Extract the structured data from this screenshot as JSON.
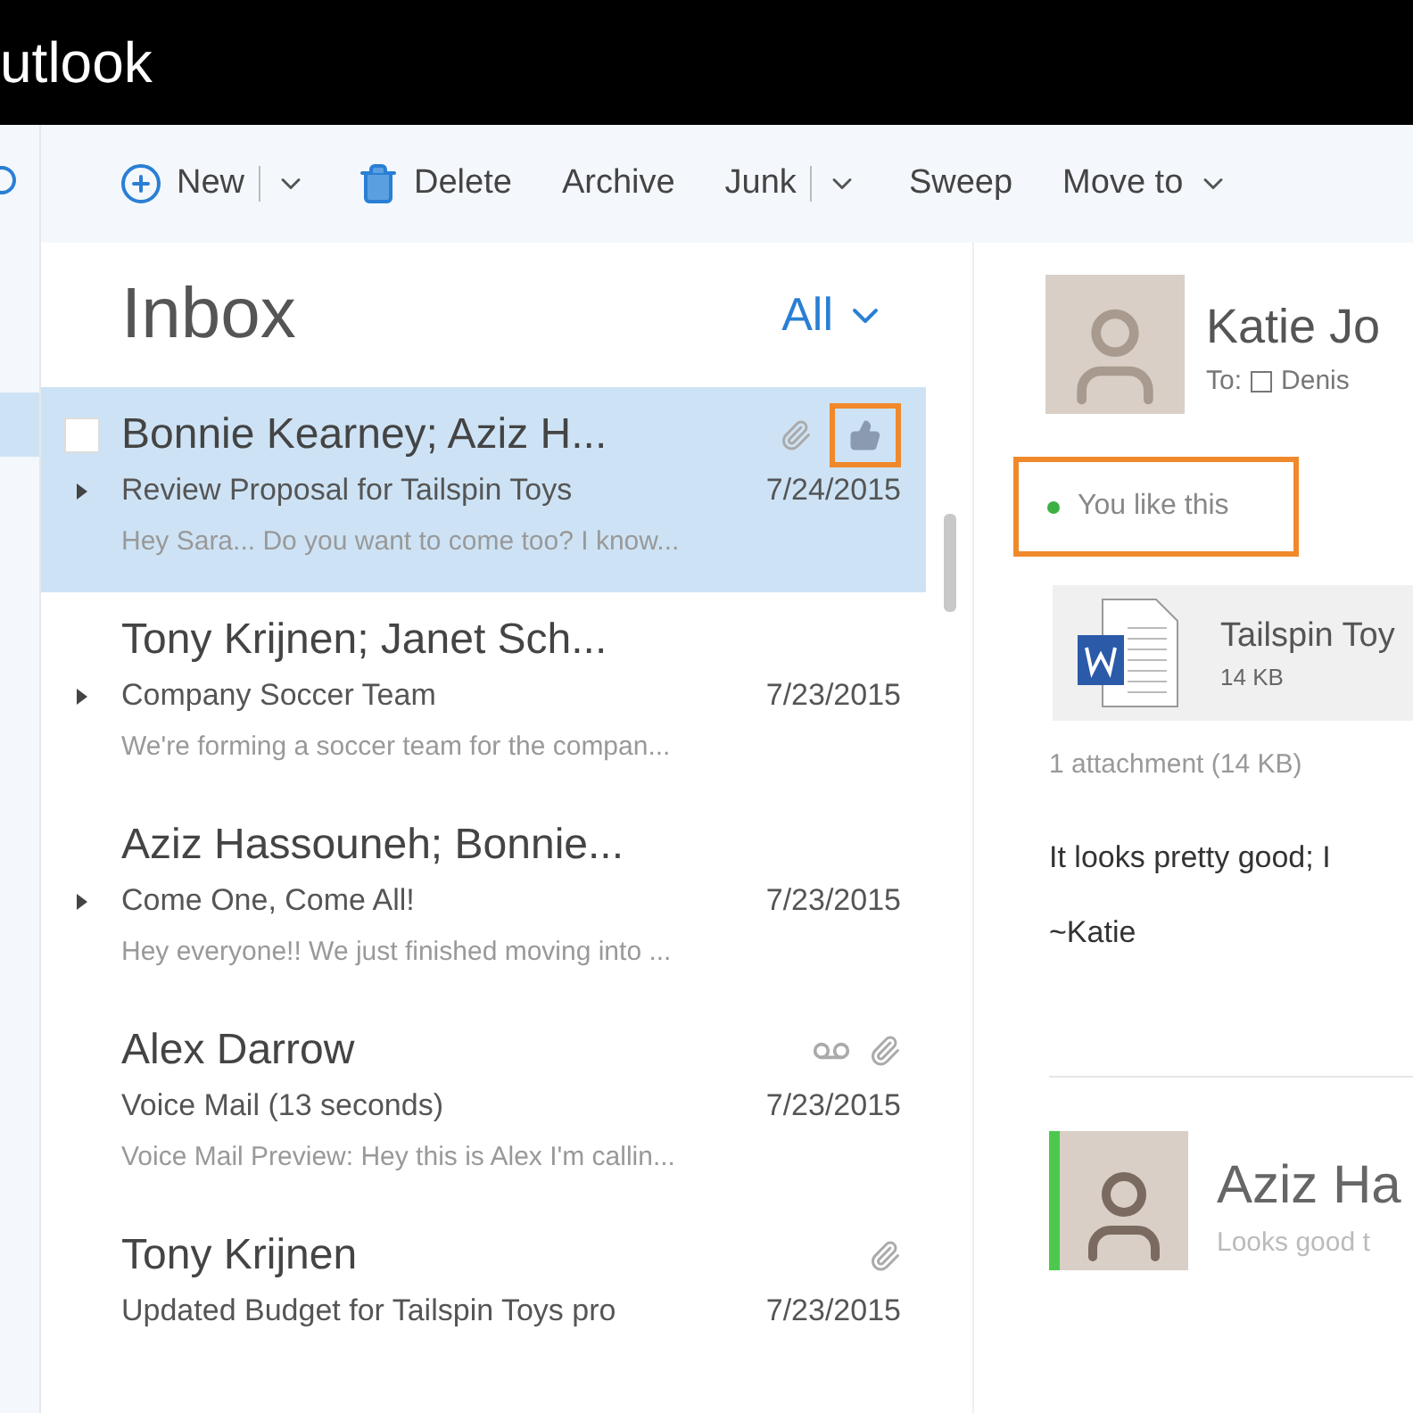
{
  "header": {
    "app_title": "utlook"
  },
  "toolbar": {
    "buttons": [
      {
        "kind": "new",
        "label": "New",
        "split": true,
        "dropdown": true
      },
      {
        "kind": "delete",
        "label": "Delete",
        "split": false,
        "dropdown": false
      },
      {
        "kind": "plain",
        "label": "Archive",
        "split": false,
        "dropdown": false
      },
      {
        "kind": "plain",
        "label": "Junk",
        "split": true,
        "dropdown": true
      },
      {
        "kind": "plain",
        "label": "Sweep",
        "split": false,
        "dropdown": false
      },
      {
        "kind": "plain",
        "label": "Move to",
        "split": false,
        "dropdown": true
      }
    ]
  },
  "inbox": {
    "title": "Inbox",
    "filter": "All",
    "messages": [
      {
        "sender": "Bonnie Kearney; Aziz H...",
        "subject": "Review Proposal for Tailspin Toys",
        "date": "7/24/2015",
        "preview": "Hey Sara... Do you want to come too? I know...",
        "selected": true,
        "checked": false,
        "thread": true,
        "voicemail": false,
        "attachment": true,
        "liked": true,
        "like_highlighted": true
      },
      {
        "sender": "Tony Krijnen; Janet Sch...",
        "subject": "Company Soccer Team",
        "date": "7/23/2015",
        "preview": "We're forming a soccer team for the compan...",
        "selected": false,
        "thread": true,
        "voicemail": false,
        "attachment": false,
        "liked": false
      },
      {
        "sender": "Aziz Hassouneh; Bonnie...",
        "subject": "Come One, Come All!",
        "date": "7/23/2015",
        "preview": "Hey everyone!! We just finished moving into ...",
        "selected": false,
        "thread": true,
        "voicemail": false,
        "attachment": false,
        "liked": false
      },
      {
        "sender": "Alex Darrow",
        "subject": "Voice Mail (13 seconds)",
        "date": "7/23/2015",
        "preview": "Voice Mail Preview:  Hey this is Alex I'm callin...",
        "selected": false,
        "thread": false,
        "voicemail": true,
        "attachment": true,
        "liked": false
      },
      {
        "sender": "Tony Krijnen",
        "subject": "Updated Budget for Tailspin Toys pro",
        "date": "7/23/2015",
        "selected": false,
        "thread": false,
        "voicemail": false,
        "attachment": true,
        "liked": false
      }
    ]
  },
  "reading_pane": {
    "sender": "Katie Jo",
    "to_label": "To:",
    "recipient": "Denis",
    "recipient_checked": false,
    "like_status": {
      "text": "You like this",
      "highlighted": true,
      "color": "#3cb043"
    },
    "attachment": {
      "name": "Tailspin Toy",
      "size": "14 KB"
    },
    "attachment_summary": "1 attachment (14 KB)",
    "body": [
      "It looks pretty good; I",
      "~Katie"
    ],
    "reply": {
      "sender": "Aziz Ha",
      "preview": "Looks good t",
      "unread": true
    }
  }
}
